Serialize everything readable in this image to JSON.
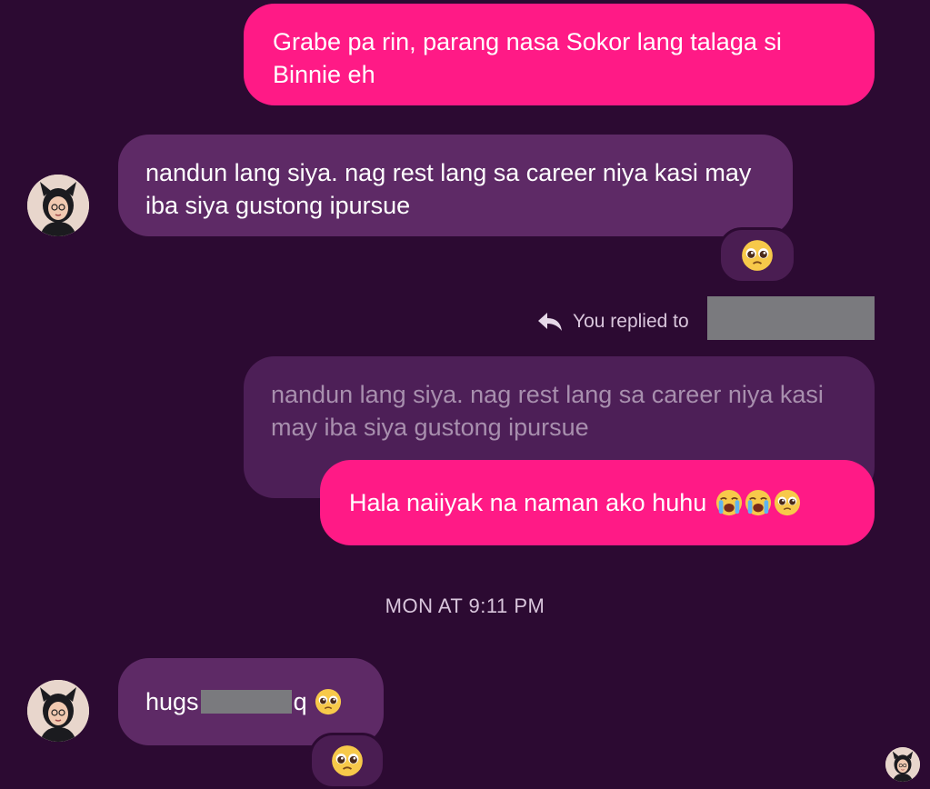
{
  "messages": {
    "m1": "Grabe pa rin, parang nasa Sokor lang talaga si Binnie eh",
    "m2": "nandun lang siya. nag rest lang sa career niya kasi may iba siya gustong ipursue",
    "replied_label": "You replied to",
    "quoted": "nandun lang siya. nag rest lang sa career niya kasi may iba siya gustong ipursue",
    "m3": "Hala naiiyak na naman ako huhu",
    "timestamp": "MON AT 9:11 PM",
    "m4_prefix": "hugs",
    "m4_suffix": "q"
  },
  "icons": {
    "reaction": "pleading-face-icon",
    "crying": "loudly-crying-face-icon",
    "reply": "reply-arrow-icon"
  },
  "colors": {
    "background": "#2c0a32",
    "outgoing": "#ff1a86",
    "incoming": "#5e2a66",
    "quoted": "#4d1f57"
  }
}
